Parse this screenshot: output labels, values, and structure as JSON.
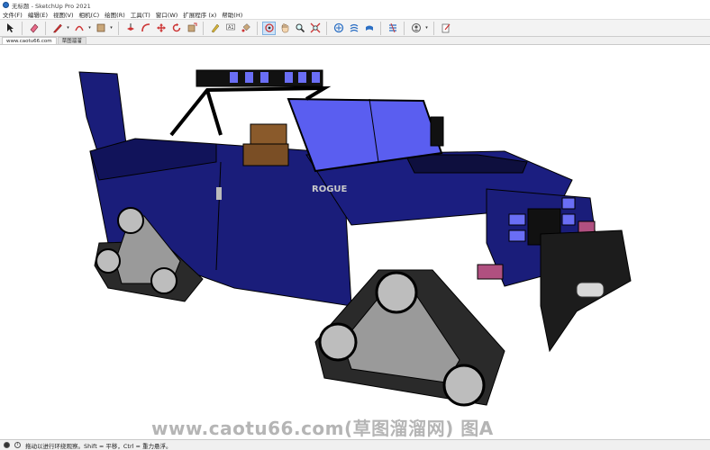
{
  "window": {
    "title": "无标题 - SketchUp Pro 2021"
  },
  "menu": [
    "文件(F)",
    "编辑(E)",
    "视图(V)",
    "相机(C)",
    "绘图(R)",
    "工具(T)",
    "窗口(W)",
    "扩展程序 (x)",
    "帮助(H)"
  ],
  "tabs": [
    "www.caotu66.com",
    "草图溜溜"
  ],
  "model": {
    "badge_text": "ROGUE"
  },
  "watermark": "www.caotu66.com(草图溜溜网) 图A",
  "status": {
    "message": "拖动以进行环绕观察。Shift = 平移，Ctrl = 重力悬浮。"
  },
  "colors": {
    "body_blue": "#1a1d7a",
    "glass_blue": "#5a5ef0",
    "tread_grey": "#9a9a9a",
    "tread_dark": "#2a2a2a",
    "seat_brown": "#8a5a2b",
    "accent_red": "#b05080"
  },
  "icons": [
    "select-arrow-icon",
    "eraser-icon",
    "pencil-icon",
    "arc-icon",
    "rectangle-icon",
    "push-pull-icon",
    "follow-me-icon",
    "move-icon",
    "rotate-icon",
    "scale-icon",
    "tape-measure-icon",
    "text-icon",
    "paint-bucket-icon",
    "orbit-icon",
    "pan-icon",
    "zoom-icon",
    "zoom-extents-icon",
    "3d-warehouse-icon",
    "extension-warehouse-icon",
    "layout-icon",
    "extension-manager-icon",
    "profile-icon",
    "notes-icon"
  ]
}
